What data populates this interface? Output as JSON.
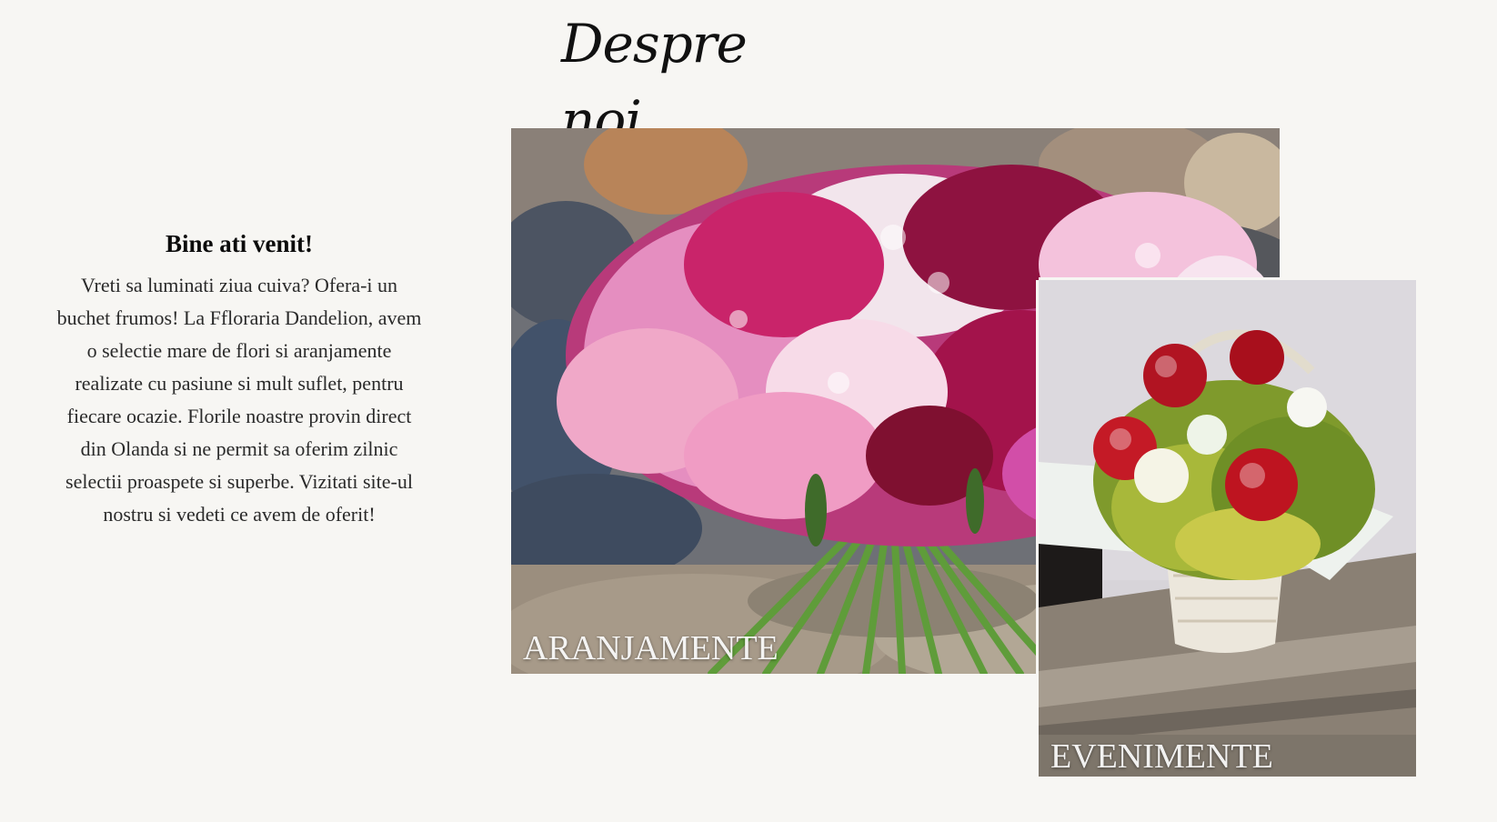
{
  "page": {
    "title": "Despre noi"
  },
  "intro": {
    "heading": "Bine ati venit!",
    "body": "Vreti sa luminati ziua cuiva? Ofera-i un buchet frumos! La Ffloraria Dandelion, avem o selectie mare de flori si aranjamente realizate cu pasiune si mult suflet, pentru fiecare ocazie. Florile noastre provin direct din Olanda si ne permit sa oferim zilnic selectii proaspete si superbe. Vizitati site-ul nostru si vedeti ce avem de oferit!"
  },
  "tiles": [
    {
      "caption": "ARANJAMENTE",
      "image": "pink-red-carnation-bouquet-on-rocks"
    },
    {
      "caption": "EVENIMENTE",
      "image": "red-white-roses-basket-on-wooden-bench"
    }
  ],
  "colors": {
    "background": "#f7f6f3",
    "caption_text": "#ffffff",
    "title_text": "#111111"
  }
}
